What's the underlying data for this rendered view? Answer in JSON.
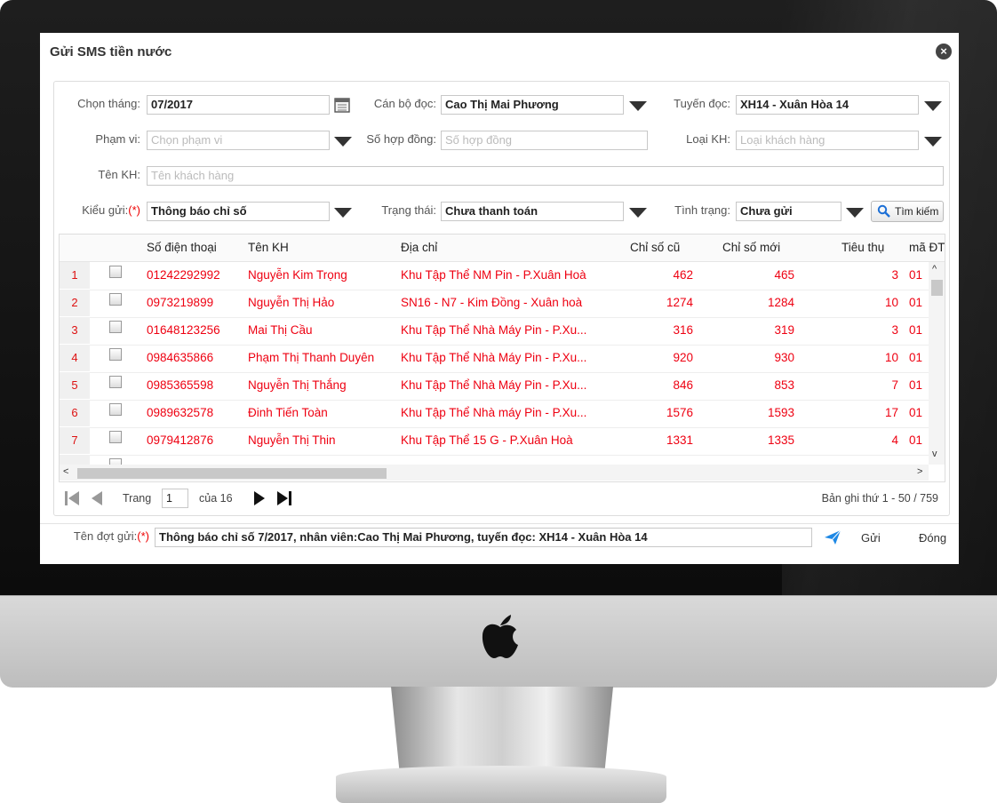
{
  "dialog": {
    "title": "Gửi SMS tiền nước"
  },
  "filters": {
    "month_label": "Chọn tháng:",
    "month_value": "07/2017",
    "reader_label": "Cán bộ đọc:",
    "reader_value": "Cao Thị Mai Phương",
    "route_label": "Tuyến đọc:",
    "route_value": "XH14 - Xuân Hòa 14",
    "scope_label": "Phạm vi:",
    "scope_placeholder": "Chọn phạm vi",
    "contract_label": "Số hợp đồng:",
    "contract_placeholder": "Số hợp đồng",
    "custtype_label": "Loại KH:",
    "custtype_placeholder": "Loại khách hàng",
    "name_label": "Tên KH:",
    "name_placeholder": "Tên khách hàng",
    "sendtype_label": "Kiểu gửi:",
    "sendtype_required": "(*)",
    "sendtype_value": "Thông báo chỉ số",
    "status_label": "Trạng thái:",
    "status_value": "Chưa thanh toán",
    "state_label": "Tình trạng:",
    "state_value": "Chưa gửi",
    "search_label": "Tìm kiếm"
  },
  "grid": {
    "columns": [
      "Số điện thoại",
      "Tên KH",
      "Địa chỉ",
      "Chỉ số cũ",
      "Chỉ số mới",
      "Tiêu thụ",
      "mã ĐT"
    ],
    "rows": [
      {
        "no": "1",
        "phone": "01242292992",
        "name": "Nguyễn Kim Trọng",
        "address": "Khu Tập Thể NM Pin - P.Xuân Hoà",
        "old": "462",
        "new": "465",
        "usage": "3",
        "code": "01"
      },
      {
        "no": "2",
        "phone": "0973219899",
        "name": "Nguyễn Thị Hảo",
        "address": "SN16 - N7 - Kim Đồng - Xuân hoà",
        "old": "1274",
        "new": "1284",
        "usage": "10",
        "code": "01"
      },
      {
        "no": "3",
        "phone": "01648123256",
        "name": "Mai Thị Cầu",
        "address": "Khu Tập Thể Nhà Máy Pin - P.Xu...",
        "old": "316",
        "new": "319",
        "usage": "3",
        "code": "01"
      },
      {
        "no": "4",
        "phone": "0984635866",
        "name": "Phạm Thị Thanh Duyên",
        "address": "Khu Tập Thể Nhà Máy Pin - P.Xu...",
        "old": "920",
        "new": "930",
        "usage": "10",
        "code": "01"
      },
      {
        "no": "5",
        "phone": "0985365598",
        "name": "Nguyễn Thị Thắng",
        "address": "Khu Tập Thể Nhà Máy Pin - P.Xu...",
        "old": "846",
        "new": "853",
        "usage": "7",
        "code": "01"
      },
      {
        "no": "6",
        "phone": "0989632578",
        "name": "Đinh Tiến Toàn",
        "address": "Khu Tập Thể Nhà máy Pin - P.Xu...",
        "old": "1576",
        "new": "1593",
        "usage": "17",
        "code": "01"
      },
      {
        "no": "7",
        "phone": "0979412876",
        "name": "Nguyễn Thị Thin",
        "address": "Khu Tập Thể 15 G - P.Xuân Hoà",
        "old": "1331",
        "new": "1335",
        "usage": "4",
        "code": "01"
      }
    ]
  },
  "pager": {
    "page_label": "Trang",
    "page_value": "1",
    "of_label": "của 16",
    "record_info": "Bản ghi thứ 1 - 50 / 759"
  },
  "footer": {
    "batch_label": "Tên đợt gửi:",
    "batch_required": "(*)",
    "batch_value": "Thông báo chỉ số 7/2017, nhân viên:Cao Thị Mai Phương, tuyến đọc: XH14 - Xuân Hòa 14",
    "send_label": "Gửi",
    "close_label": "Đóng"
  },
  "colors": {
    "accent_red": "#e01010",
    "send_icon": "#1e88e5"
  }
}
